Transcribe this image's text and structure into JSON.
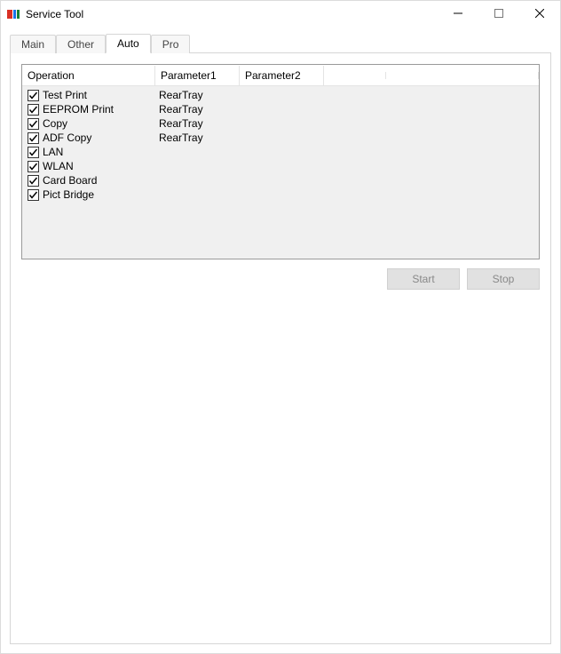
{
  "window": {
    "title": "Service Tool"
  },
  "tabs": {
    "main": "Main",
    "other": "Other",
    "auto": "Auto",
    "pro": "Pro"
  },
  "listview": {
    "headers": {
      "operation": "Operation",
      "parameter1": "Parameter1",
      "parameter2": "Parameter2"
    },
    "rows": [
      {
        "checked": true,
        "operation": "Test Print",
        "parameter1": "RearTray",
        "parameter2": ""
      },
      {
        "checked": true,
        "operation": "EEPROM Print",
        "parameter1": "RearTray",
        "parameter2": ""
      },
      {
        "checked": true,
        "operation": "Copy",
        "parameter1": "RearTray",
        "parameter2": ""
      },
      {
        "checked": true,
        "operation": "ADF Copy",
        "parameter1": "RearTray",
        "parameter2": ""
      },
      {
        "checked": true,
        "operation": "LAN",
        "parameter1": "",
        "parameter2": ""
      },
      {
        "checked": true,
        "operation": "WLAN",
        "parameter1": "",
        "parameter2": ""
      },
      {
        "checked": true,
        "operation": "Card Board",
        "parameter1": "",
        "parameter2": ""
      },
      {
        "checked": true,
        "operation": "Pict Bridge",
        "parameter1": "",
        "parameter2": ""
      }
    ]
  },
  "buttons": {
    "start": "Start",
    "stop": "Stop"
  }
}
